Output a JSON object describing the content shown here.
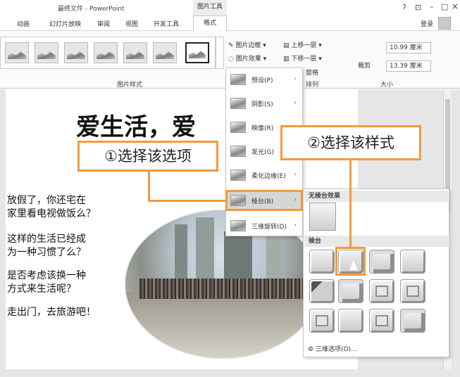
{
  "window": {
    "title": "最终文件 - PowerPoint",
    "context_group": "图片工具",
    "help": "?",
    "restore": "⊡",
    "minimize": "–",
    "maximize": "□",
    "close": "×",
    "login": "登录"
  },
  "tabs": [
    "动画",
    "幻灯片放映",
    "审阅",
    "视图",
    "开发工具"
  ],
  "active_tab": "格式",
  "ribbon": {
    "picture_border": "图片边框",
    "picture_effects": "图片效果",
    "bring_forward": "上移一层",
    "send_backward": "下移一层",
    "selection_pane_partial": "窗格",
    "crop": "裁剪",
    "height": "10.99 厘米",
    "width": "13.39 厘米",
    "group_picture_styles": "图片样式",
    "group_arrange": "排列",
    "group_size": "大小",
    "dropdown_arrow": "▾",
    "spin_arrow": "⌃"
  },
  "slide": {
    "headline": "爱生活，爱",
    "paragraphs": [
      [
        "放假了，你还宅在",
        "家里看电视做饭么？"
      ],
      [
        "这样的生活已经成",
        "为一种习惯了么？"
      ],
      [
        "是否考虑该换一种",
        "方式来生活呢？"
      ],
      [
        "走出门，去旅游吧！"
      ]
    ]
  },
  "effects_menu": {
    "items": [
      {
        "label": "预设(P)",
        "arrow": "›"
      },
      {
        "label": "阴影(S)",
        "arrow": "›"
      },
      {
        "label": "映像(R)",
        "arrow": "›"
      },
      {
        "label": "发光(G)",
        "arrow": "›"
      },
      {
        "label": "柔化边缘(E)",
        "arrow": "›"
      },
      {
        "label": "棱台(B)",
        "arrow": "›"
      },
      {
        "label": "三维旋转(D)",
        "arrow": "›"
      }
    ]
  },
  "bevel_submenu": {
    "no_bevel_header": "无棱台效果",
    "bevel_header": "棱台",
    "more_options": "三维选项(O)..."
  },
  "callouts": {
    "step1": "①选择该选项",
    "step2": "②选择该样式"
  },
  "colors": {
    "accent_orange": "#f39a3e"
  }
}
